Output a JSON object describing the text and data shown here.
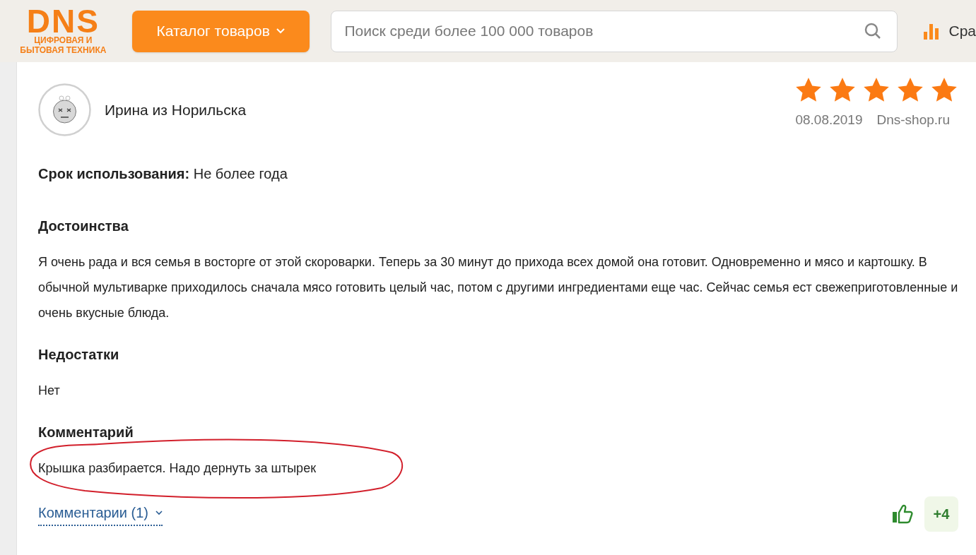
{
  "header": {
    "logo": {
      "brand": "DNS",
      "tagline_lines": [
        "ЦИФРОВАЯ И",
        "БЫТОВАЯ ТЕХНИКА"
      ]
    },
    "catalog_button": "Каталог товаров",
    "search": {
      "placeholder": "Поиск среди более 100 000 товаров"
    },
    "compare": {
      "label": "Сра"
    }
  },
  "review": {
    "author": "Ирина из Норильска",
    "stars": 5,
    "date": "08.08.2019",
    "source": "Dns-shop.ru",
    "usage": {
      "label": "Срок использования:",
      "value": "Не более года"
    },
    "sections": [
      {
        "heading": "Достоинства",
        "text": "Я очень рада и вся семья в восторге от этой скороварки. Теперь за 30 минут до прихода всех домой она готовит. Одновременно и мясо и картошку. В обычной мультиварке приходилось сначала мясо готовить целый час, потом с другими ингредиентами еще час. Сейчас семья ест свежеприготовленные и очень вкусные блюда.",
        "circled": false
      },
      {
        "heading": "Недостатки",
        "text": "Нет",
        "circled": false
      },
      {
        "heading": "Комментарий",
        "text": "Крышка разбирается. Надо дернуть за штырек",
        "circled": true
      }
    ],
    "comments_link": "Комментарии (1)",
    "likes": "+4"
  }
}
